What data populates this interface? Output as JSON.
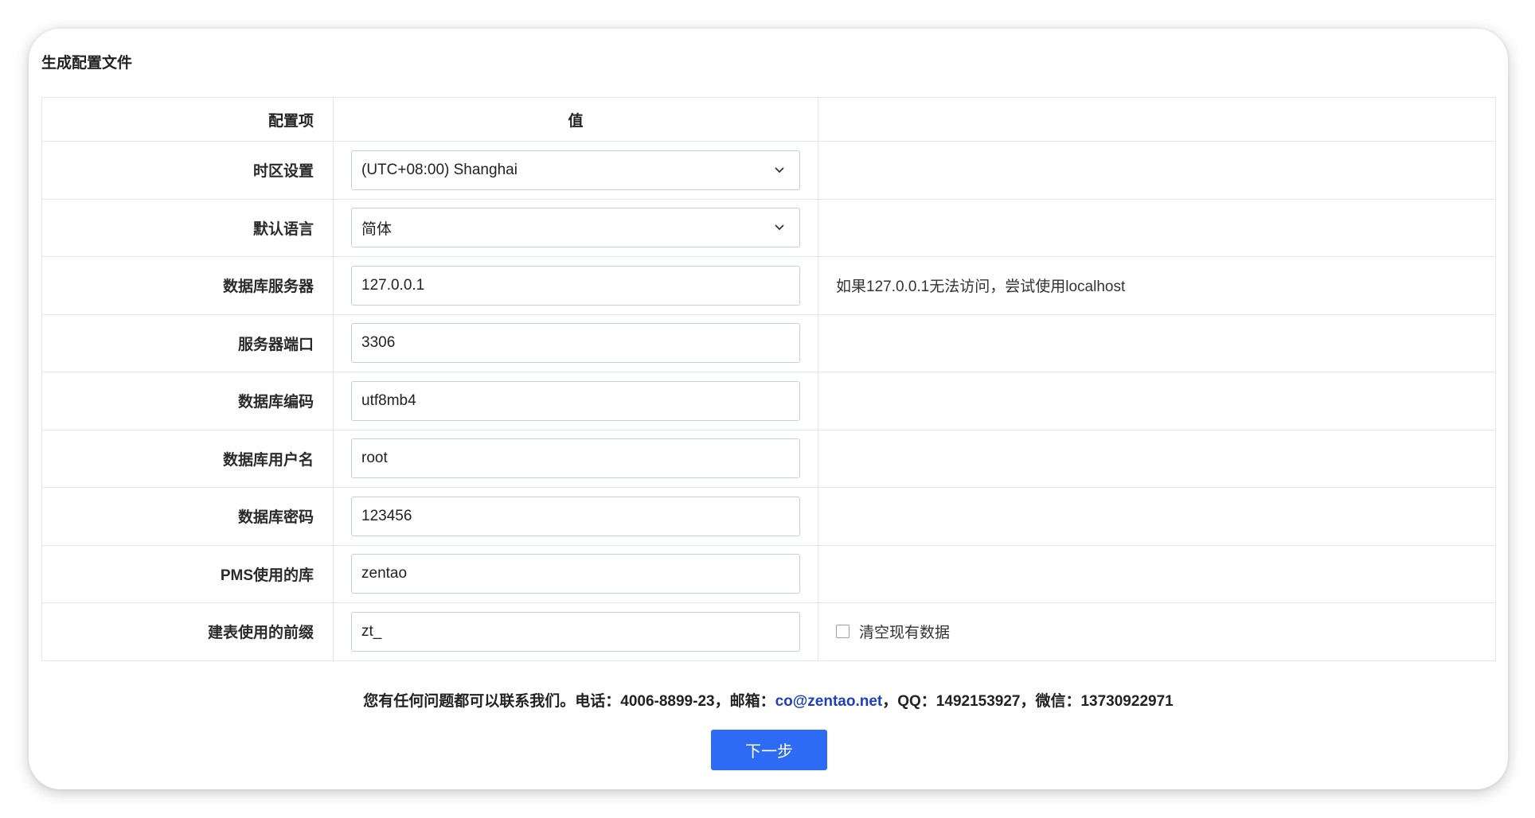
{
  "panel": {
    "title": "生成配置文件"
  },
  "table": {
    "headers": [
      "配置项",
      "值",
      ""
    ],
    "rows": [
      {
        "label": "时区设置",
        "value": "(UTC+08:00) Shanghai",
        "note": ""
      },
      {
        "label": "默认语言",
        "value": "简体",
        "note": ""
      },
      {
        "label": "数据库服务器",
        "value": "127.0.0.1",
        "note": "如果127.0.0.1无法访问，尝试使用localhost"
      },
      {
        "label": "服务器端口",
        "value": "3306",
        "note": ""
      },
      {
        "label": "数据库编码",
        "value": "utf8mb4",
        "note": ""
      },
      {
        "label": "数据库用户名",
        "value": "root",
        "note": ""
      },
      {
        "label": "数据库密码",
        "value": "123456",
        "note": ""
      },
      {
        "label": "PMS使用的库",
        "value": "zentao",
        "note": ""
      },
      {
        "label": "建表使用的前缀",
        "value": "zt_",
        "note": ""
      }
    ],
    "clear_data_label": "清空现有数据"
  },
  "contact": {
    "prefix": "您有任何问题都可以联系我们。电话：4006-8899-23，邮箱：",
    "email": "co@zentao.net",
    "suffix": "，QQ：1492153927，微信：13730922971"
  },
  "buttons": {
    "next": "下一步"
  },
  "colors": {
    "primary": "#2e6bf5",
    "link": "#1f3fbf",
    "border": "#e3e6eb"
  },
  "icons": {
    "select_arrow": "chevron-down-icon"
  }
}
